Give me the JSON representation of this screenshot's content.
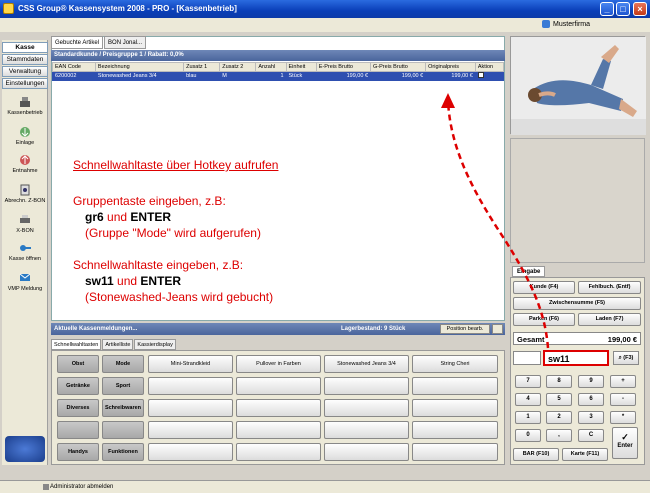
{
  "window": {
    "title": "CSS Group® Kassensystem 2008 - PRO - [Kassenbetrieb]"
  },
  "firm": "Musterfirma",
  "nav_tabs": [
    "Kasse",
    "Stammdaten",
    "Verwaltung",
    "Einstellungen"
  ],
  "side_items": [
    "Kassenbetrieb",
    "Einlage",
    "Entnahme",
    "Abrechn. Z-BON",
    "X-BON",
    "Kasse öffnen",
    "VMP Meldung"
  ],
  "top_tabs": [
    "Gebuchte Artikel",
    "BON Jonal..."
  ],
  "kunde_info": "Standardkunde / Preisgruppe 1 / Rabatt: 0,0%",
  "table": {
    "headers": [
      "EAN Code",
      "Bezeichnung",
      "Zusatz 1",
      "Zusatz 2",
      "Anzahl",
      "Einheit",
      "E-Preis Brutto",
      "G-Preis Brutto",
      "Originalpreis",
      "Aktion"
    ],
    "row": [
      "6200002",
      "Stonewashed Jeans 3/4",
      "blau",
      "M",
      "1",
      "Stück",
      "199,00 €",
      "199,00 €",
      "199,00 €"
    ]
  },
  "notes": {
    "heading": "Schnellwahltaste über Hotkey aufrufen",
    "g1": "Gruppentaste eingeben, z.B:",
    "g2_cmd": "gr6",
    "g2_und": "und",
    "g2_key": "ENTER",
    "g3": "(Gruppe \"Mode\" wird aufgerufen)",
    "s1": "Schnellwahltaste eingeben, z.B:",
    "s2_cmd": "sw11",
    "s2_und": "und",
    "s2_key": "ENTER",
    "s3": "(Stonewashed-Jeans wird gebucht)"
  },
  "msgbar": {
    "title": "Aktuelle Kassenmeldungen...",
    "lager": "Lagerbestand: 9 Stück",
    "pos_button": "Position bearb."
  },
  "bottom_tabs": [
    "Schnellwahltasten",
    "Artikelliste",
    "Kassierdisplay"
  ],
  "groups": [
    "Obst",
    "Mode",
    "Getränke",
    "Sport",
    "Diverses",
    "Schreibwaren",
    "",
    "",
    "Handys",
    "Funktionen"
  ],
  "quick_items": [
    "Mini-Strandkleid",
    "Pullover in Farben",
    "Stonewashed Jeans 3/4",
    "String Cheri"
  ],
  "eingabe": {
    "tab": "Eingabe",
    "kunde": "Kunde (F4)",
    "fehlbuch": "Fehlbuch. (Entf)",
    "zwischensumme": "Zwischensumme (F5)",
    "parken": "Parken (F6)",
    "laden": "Laden (F7)",
    "gesamt_label": "Gesamt",
    "gesamt_value": "199,00 €",
    "input_value": "sw11",
    "f3": "(F3)",
    "bar": "BAR (F10)",
    "karte": "Karte (F11)",
    "enter": "Enter"
  },
  "keypad": [
    "7",
    "8",
    "9",
    "+",
    "4",
    "5",
    "6",
    "-",
    "1",
    "2",
    "3",
    "*",
    "0",
    ",",
    "C"
  ],
  "status": "Administrator abmelden"
}
